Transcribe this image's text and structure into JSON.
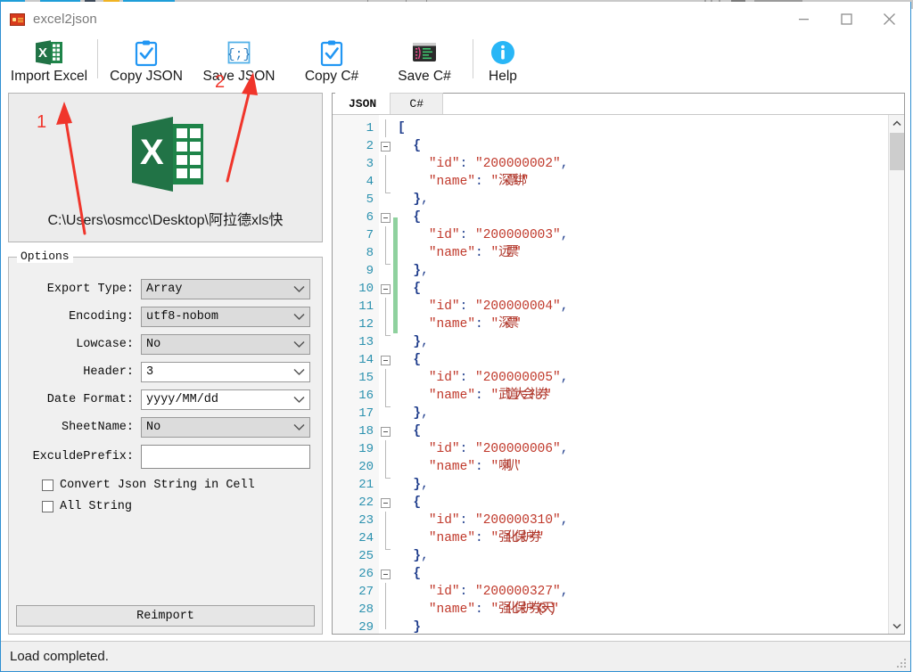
{
  "window": {
    "title": "excel2json",
    "app_icon": "app-logo-icon",
    "controls": {
      "minimize": "minimize-icon",
      "maximize": "maximize-icon",
      "close": "close-icon"
    }
  },
  "toolbar": {
    "items": [
      {
        "label": "Import Excel",
        "icon": "excel-file-icon"
      },
      {
        "label": "Copy JSON",
        "icon": "clipboard-check-icon"
      },
      {
        "label": "Save JSON",
        "icon": "braces-icon"
      },
      {
        "label": "Copy C#",
        "icon": "clipboard-check-icon"
      },
      {
        "label": "Save C#",
        "icon": "code-terminal-icon"
      },
      {
        "label": "Help",
        "icon": "info-circle-icon"
      }
    ]
  },
  "file_panel": {
    "logo": "excel-logo-icon",
    "path": "C:\\Users\\osmcc\\Desktop\\阿拉德xls快"
  },
  "annotations": {
    "color": "#f0352b",
    "marks": [
      {
        "number": "1",
        "target": "import-excel-button"
      },
      {
        "number": "2",
        "target": "save-json-button"
      }
    ]
  },
  "options": {
    "legend": "Options",
    "fields": [
      {
        "label": "Export Type:",
        "value": "Array",
        "type": "combo",
        "style": "grey"
      },
      {
        "label": "Encoding:",
        "value": "utf8-nobom",
        "type": "combo",
        "style": "grey"
      },
      {
        "label": "Lowcase:",
        "value": "No",
        "type": "combo",
        "style": "grey"
      },
      {
        "label": "Header:",
        "value": "3",
        "type": "combo",
        "style": "white"
      },
      {
        "label": "Date Format:",
        "value": "yyyy/MM/dd",
        "type": "combo",
        "style": "white"
      },
      {
        "label": "SheetName:",
        "value": "No",
        "type": "combo",
        "style": "grey"
      },
      {
        "label": "ExculdePrefix:",
        "value": "",
        "type": "text",
        "style": "white",
        "placeholder": ""
      }
    ],
    "checkboxes": [
      {
        "label": "Convert Json String in Cell",
        "checked": false
      },
      {
        "label": "All String",
        "checked": false
      }
    ],
    "reimport_label": "Reimport"
  },
  "editor": {
    "tabs": [
      {
        "label": "JSON",
        "active": true
      },
      {
        "label": "C#",
        "active": false
      }
    ],
    "first_line": 1,
    "lines": [
      {
        "n": 1,
        "text": "["
      },
      {
        "n": 2,
        "text": "  {"
      },
      {
        "n": 3,
        "text": "    \"id\": \"200000002\","
      },
      {
        "n": 4,
        "text": "    \"name\": \"深票绑\""
      },
      {
        "n": 5,
        "text": "  },"
      },
      {
        "n": 6,
        "text": "  {"
      },
      {
        "n": 7,
        "text": "    \"id\": \"200000003\","
      },
      {
        "n": 8,
        "text": "    \"name\": \"远票\""
      },
      {
        "n": 9,
        "text": "  },"
      },
      {
        "n": 10,
        "text": "  {"
      },
      {
        "n": 11,
        "text": "    \"id\": \"200000004\","
      },
      {
        "n": 12,
        "text": "    \"name\": \"深票\""
      },
      {
        "n": 13,
        "text": "  },"
      },
      {
        "n": 14,
        "text": "  {"
      },
      {
        "n": 15,
        "text": "    \"id\": \"200000005\","
      },
      {
        "n": 16,
        "text": "    \"name\": \"武道大会礼券\""
      },
      {
        "n": 17,
        "text": "  },"
      },
      {
        "n": 18,
        "text": "  {"
      },
      {
        "n": 19,
        "text": "    \"id\": \"200000006\","
      },
      {
        "n": 20,
        "text": "    \"name\": \"喇叭\""
      },
      {
        "n": 21,
        "text": "  },"
      },
      {
        "n": 22,
        "text": "  {"
      },
      {
        "n": 23,
        "text": "    \"id\": \"200000310\","
      },
      {
        "n": 24,
        "text": "    \"name\": \"强化保护券\""
      },
      {
        "n": 25,
        "text": "  },"
      },
      {
        "n": 26,
        "text": "  {"
      },
      {
        "n": 27,
        "text": "    \"id\": \"200000327\","
      },
      {
        "n": 28,
        "text": "    \"name\": \"强化保护券(3天)\""
      },
      {
        "n": 29,
        "text": "  }"
      }
    ],
    "fold_lines": [
      2,
      6,
      10,
      14,
      18,
      22,
      26
    ],
    "scrollbar": {
      "up": "chevron-up-icon",
      "down": "chevron-down-icon"
    }
  },
  "statusbar": {
    "text": "Load completed."
  },
  "colors": {
    "accent": "#2e8fd1",
    "excel_green": "#217346",
    "annotation_red": "#f0352b",
    "json_string": "#c0392b",
    "json_bracket": "#1f3d8c",
    "line_number": "#2b91af",
    "change_bar": "#8fd19e"
  }
}
